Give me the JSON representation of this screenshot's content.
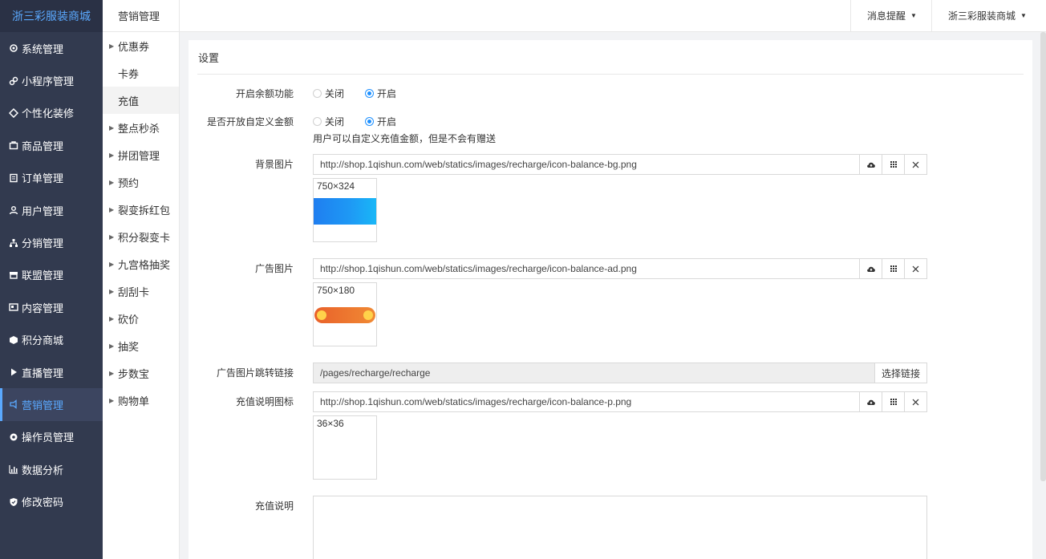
{
  "brand": "浙三彩服装商城",
  "menu": [
    {
      "label": "系统管理",
      "icon": "gear-icon"
    },
    {
      "label": "小程序管理",
      "icon": "miniprogram-icon"
    },
    {
      "label": "个性化装修",
      "icon": "decorate-icon"
    },
    {
      "label": "商品管理",
      "icon": "shopping-bag-icon"
    },
    {
      "label": "订单管理",
      "icon": "order-icon"
    },
    {
      "label": "用户管理",
      "icon": "user-icon"
    },
    {
      "label": "分销管理",
      "icon": "sitemap-icon"
    },
    {
      "label": "联盟管理",
      "icon": "store-icon"
    },
    {
      "label": "内容管理",
      "icon": "content-icon"
    },
    {
      "label": "积分商城",
      "icon": "cube-icon"
    },
    {
      "label": "直播管理",
      "icon": "play-icon"
    },
    {
      "label": "营销管理",
      "icon": "marketing-icon"
    },
    {
      "label": "操作员管理",
      "icon": "cog-icon"
    },
    {
      "label": "数据分析",
      "icon": "bar-chart-icon"
    },
    {
      "label": "修改密码",
      "icon": "shield-icon"
    }
  ],
  "submenu": {
    "title": "营销管理",
    "items": [
      {
        "label": "优惠券"
      },
      {
        "label": "卡券"
      },
      {
        "label": "充值"
      },
      {
        "label": "整点秒杀"
      },
      {
        "label": "拼团管理"
      },
      {
        "label": "预约"
      },
      {
        "label": "裂变拆红包"
      },
      {
        "label": "积分裂变卡"
      },
      {
        "label": "九宫格抽奖"
      },
      {
        "label": "刮刮卡"
      },
      {
        "label": "砍价"
      },
      {
        "label": "抽奖"
      },
      {
        "label": "步数宝"
      },
      {
        "label": "购物单"
      }
    ]
  },
  "topbar": {
    "notify": "消息提醒",
    "shop": "浙三彩服装商城"
  },
  "panel": {
    "heading": "设置",
    "balance_label": "开启余额功能",
    "custom_label": "是否开放自定义金额",
    "off": "关闭",
    "on": "开启",
    "custom_hint": "用户可以自定义充值金额，但是不会有赠送",
    "bg_label": "背景图片",
    "bg_url": "http://shop.1qishun.com/web/statics/images/recharge/icon-balance-bg.png",
    "bg_dim": "750×324",
    "ad_label": "广告图片",
    "ad_url": "http://shop.1qishun.com/web/statics/images/recharge/icon-balance-ad.png",
    "ad_dim": "750×180",
    "link_label": "广告图片跳转链接",
    "link_value": "/pages/recharge/recharge",
    "choose_link": "选择链接",
    "icon_label": "充值说明图标",
    "icon_url": "http://shop.1qishun.com/web/statics/images/recharge/icon-balance-p.png",
    "icon_dim": "36×36",
    "desc_label": "充值说明"
  },
  "accent_color": "#1e90ff",
  "sidebar_color": "#323a4f"
}
